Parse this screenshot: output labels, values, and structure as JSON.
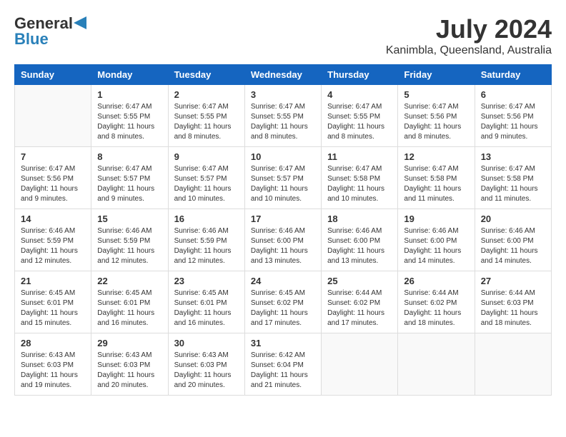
{
  "header": {
    "logo_general": "General",
    "logo_blue": "Blue",
    "title": "July 2024",
    "subtitle": "Kanimbla, Queensland, Australia"
  },
  "days_of_week": [
    "Sunday",
    "Monday",
    "Tuesday",
    "Wednesday",
    "Thursday",
    "Friday",
    "Saturday"
  ],
  "weeks": [
    [
      {
        "day": "",
        "sunrise": "",
        "sunset": "",
        "daylight": "",
        "empty": true
      },
      {
        "day": "1",
        "sunrise": "Sunrise: 6:47 AM",
        "sunset": "Sunset: 5:55 PM",
        "daylight": "Daylight: 11 hours and 8 minutes."
      },
      {
        "day": "2",
        "sunrise": "Sunrise: 6:47 AM",
        "sunset": "Sunset: 5:55 PM",
        "daylight": "Daylight: 11 hours and 8 minutes."
      },
      {
        "day": "3",
        "sunrise": "Sunrise: 6:47 AM",
        "sunset": "Sunset: 5:55 PM",
        "daylight": "Daylight: 11 hours and 8 minutes."
      },
      {
        "day": "4",
        "sunrise": "Sunrise: 6:47 AM",
        "sunset": "Sunset: 5:55 PM",
        "daylight": "Daylight: 11 hours and 8 minutes."
      },
      {
        "day": "5",
        "sunrise": "Sunrise: 6:47 AM",
        "sunset": "Sunset: 5:56 PM",
        "daylight": "Daylight: 11 hours and 8 minutes."
      },
      {
        "day": "6",
        "sunrise": "Sunrise: 6:47 AM",
        "sunset": "Sunset: 5:56 PM",
        "daylight": "Daylight: 11 hours and 9 minutes."
      }
    ],
    [
      {
        "day": "7",
        "sunrise": "Sunrise: 6:47 AM",
        "sunset": "Sunset: 5:56 PM",
        "daylight": "Daylight: 11 hours and 9 minutes."
      },
      {
        "day": "8",
        "sunrise": "Sunrise: 6:47 AM",
        "sunset": "Sunset: 5:57 PM",
        "daylight": "Daylight: 11 hours and 9 minutes."
      },
      {
        "day": "9",
        "sunrise": "Sunrise: 6:47 AM",
        "sunset": "Sunset: 5:57 PM",
        "daylight": "Daylight: 11 hours and 10 minutes."
      },
      {
        "day": "10",
        "sunrise": "Sunrise: 6:47 AM",
        "sunset": "Sunset: 5:57 PM",
        "daylight": "Daylight: 11 hours and 10 minutes."
      },
      {
        "day": "11",
        "sunrise": "Sunrise: 6:47 AM",
        "sunset": "Sunset: 5:58 PM",
        "daylight": "Daylight: 11 hours and 10 minutes."
      },
      {
        "day": "12",
        "sunrise": "Sunrise: 6:47 AM",
        "sunset": "Sunset: 5:58 PM",
        "daylight": "Daylight: 11 hours and 11 minutes."
      },
      {
        "day": "13",
        "sunrise": "Sunrise: 6:47 AM",
        "sunset": "Sunset: 5:58 PM",
        "daylight": "Daylight: 11 hours and 11 minutes."
      }
    ],
    [
      {
        "day": "14",
        "sunrise": "Sunrise: 6:46 AM",
        "sunset": "Sunset: 5:59 PM",
        "daylight": "Daylight: 11 hours and 12 minutes."
      },
      {
        "day": "15",
        "sunrise": "Sunrise: 6:46 AM",
        "sunset": "Sunset: 5:59 PM",
        "daylight": "Daylight: 11 hours and 12 minutes."
      },
      {
        "day": "16",
        "sunrise": "Sunrise: 6:46 AM",
        "sunset": "Sunset: 5:59 PM",
        "daylight": "Daylight: 11 hours and 12 minutes."
      },
      {
        "day": "17",
        "sunrise": "Sunrise: 6:46 AM",
        "sunset": "Sunset: 6:00 PM",
        "daylight": "Daylight: 11 hours and 13 minutes."
      },
      {
        "day": "18",
        "sunrise": "Sunrise: 6:46 AM",
        "sunset": "Sunset: 6:00 PM",
        "daylight": "Daylight: 11 hours and 13 minutes."
      },
      {
        "day": "19",
        "sunrise": "Sunrise: 6:46 AM",
        "sunset": "Sunset: 6:00 PM",
        "daylight": "Daylight: 11 hours and 14 minutes."
      },
      {
        "day": "20",
        "sunrise": "Sunrise: 6:46 AM",
        "sunset": "Sunset: 6:00 PM",
        "daylight": "Daylight: 11 hours and 14 minutes."
      }
    ],
    [
      {
        "day": "21",
        "sunrise": "Sunrise: 6:45 AM",
        "sunset": "Sunset: 6:01 PM",
        "daylight": "Daylight: 11 hours and 15 minutes."
      },
      {
        "day": "22",
        "sunrise": "Sunrise: 6:45 AM",
        "sunset": "Sunset: 6:01 PM",
        "daylight": "Daylight: 11 hours and 16 minutes."
      },
      {
        "day": "23",
        "sunrise": "Sunrise: 6:45 AM",
        "sunset": "Sunset: 6:01 PM",
        "daylight": "Daylight: 11 hours and 16 minutes."
      },
      {
        "day": "24",
        "sunrise": "Sunrise: 6:45 AM",
        "sunset": "Sunset: 6:02 PM",
        "daylight": "Daylight: 11 hours and 17 minutes."
      },
      {
        "day": "25",
        "sunrise": "Sunrise: 6:44 AM",
        "sunset": "Sunset: 6:02 PM",
        "daylight": "Daylight: 11 hours and 17 minutes."
      },
      {
        "day": "26",
        "sunrise": "Sunrise: 6:44 AM",
        "sunset": "Sunset: 6:02 PM",
        "daylight": "Daylight: 11 hours and 18 minutes."
      },
      {
        "day": "27",
        "sunrise": "Sunrise: 6:44 AM",
        "sunset": "Sunset: 6:03 PM",
        "daylight": "Daylight: 11 hours and 18 minutes."
      }
    ],
    [
      {
        "day": "28",
        "sunrise": "Sunrise: 6:43 AM",
        "sunset": "Sunset: 6:03 PM",
        "daylight": "Daylight: 11 hours and 19 minutes."
      },
      {
        "day": "29",
        "sunrise": "Sunrise: 6:43 AM",
        "sunset": "Sunset: 6:03 PM",
        "daylight": "Daylight: 11 hours and 20 minutes."
      },
      {
        "day": "30",
        "sunrise": "Sunrise: 6:43 AM",
        "sunset": "Sunset: 6:03 PM",
        "daylight": "Daylight: 11 hours and 20 minutes."
      },
      {
        "day": "31",
        "sunrise": "Sunrise: 6:42 AM",
        "sunset": "Sunset: 6:04 PM",
        "daylight": "Daylight: 11 hours and 21 minutes."
      },
      {
        "day": "",
        "sunrise": "",
        "sunset": "",
        "daylight": "",
        "empty": true
      },
      {
        "day": "",
        "sunrise": "",
        "sunset": "",
        "daylight": "",
        "empty": true
      },
      {
        "day": "",
        "sunrise": "",
        "sunset": "",
        "daylight": "",
        "empty": true
      }
    ]
  ]
}
